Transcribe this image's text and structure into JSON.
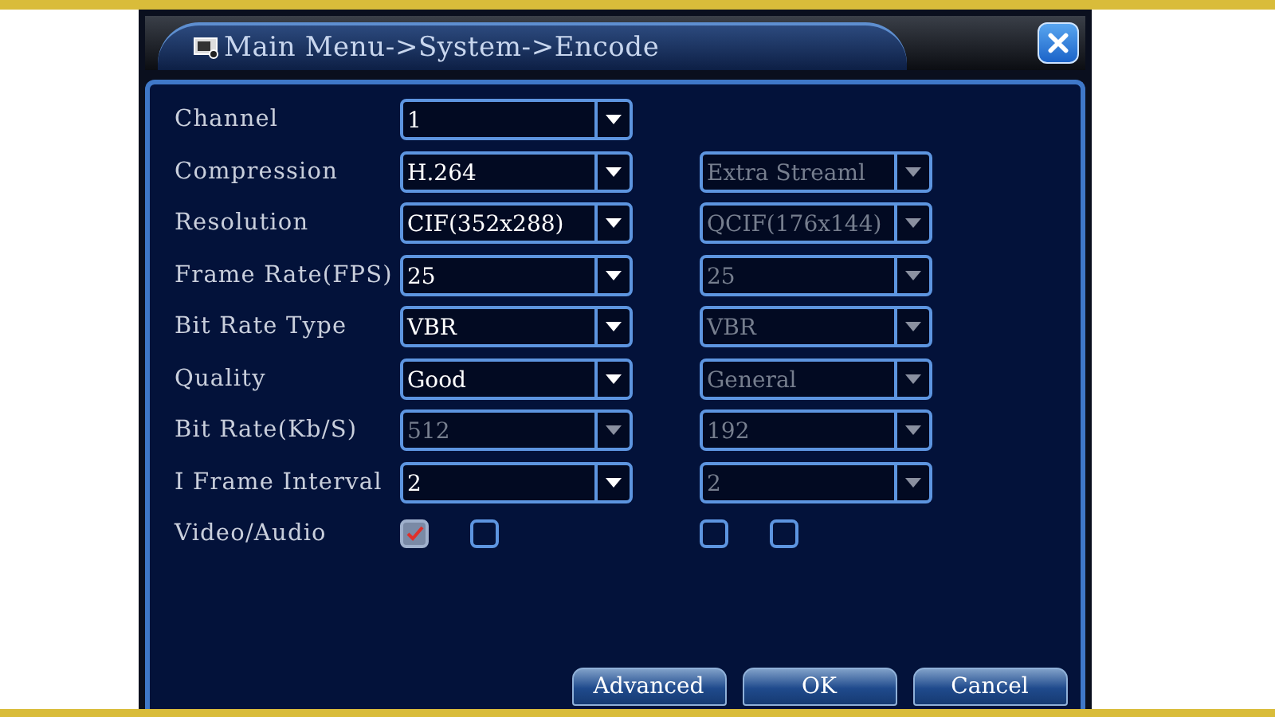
{
  "window": {
    "title": "Main Menu->System->Encode"
  },
  "rows": [
    {
      "kind": "select",
      "label": "Channel",
      "main": {
        "value": "1",
        "disabled": false
      }
    },
    {
      "kind": "select",
      "label": "Compression",
      "main": {
        "value": "H.264",
        "disabled": false
      },
      "extra": {
        "value": "Extra Streaml",
        "disabled": true
      }
    },
    {
      "kind": "select",
      "label": "Resolution",
      "main": {
        "value": "CIF(352x288)",
        "disabled": false
      },
      "extra": {
        "value": "QCIF(176x144)",
        "disabled": true
      }
    },
    {
      "kind": "select",
      "label": "Frame Rate(FPS)",
      "main": {
        "value": "25",
        "disabled": false
      },
      "extra": {
        "value": "25",
        "disabled": true
      }
    },
    {
      "kind": "select",
      "label": "Bit Rate Type",
      "main": {
        "value": "VBR",
        "disabled": false
      },
      "extra": {
        "value": "VBR",
        "disabled": true
      }
    },
    {
      "kind": "select",
      "label": "Quality",
      "main": {
        "value": "Good",
        "disabled": false
      },
      "extra": {
        "value": "General",
        "disabled": true
      }
    },
    {
      "kind": "select",
      "label": "Bit Rate(Kb/S)",
      "main": {
        "value": "512",
        "disabled": true
      },
      "extra": {
        "value": "192",
        "disabled": true
      }
    },
    {
      "kind": "select",
      "label": "I Frame Interval",
      "main": {
        "value": "2",
        "disabled": false
      },
      "extra": {
        "value": "2",
        "disabled": true
      }
    },
    {
      "kind": "checks",
      "label": "Video/Audio",
      "main": [
        {
          "checked": true
        },
        {
          "checked": false
        }
      ],
      "extra": [
        {
          "checked": false
        },
        {
          "checked": false
        }
      ]
    }
  ],
  "buttons": [
    "Advanced",
    "OK",
    "Cancel"
  ]
}
